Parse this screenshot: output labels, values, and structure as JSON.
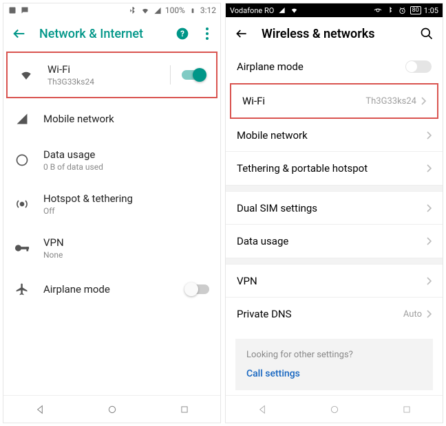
{
  "left": {
    "statusbar": {
      "battery": "100%",
      "time": "3:12"
    },
    "header": {
      "title": "Network & Internet"
    },
    "items": {
      "wifi": {
        "label": "Wi-Fi",
        "sub": "Th3G33ks24"
      },
      "mobile": {
        "label": "Mobile network"
      },
      "data": {
        "label": "Data usage",
        "sub": "0 B of data used"
      },
      "hotspot": {
        "label": "Hotspot & tethering",
        "sub": "Off"
      },
      "vpn": {
        "label": "VPN",
        "sub": "None"
      },
      "airplane": {
        "label": "Airplane mode"
      }
    }
  },
  "right": {
    "statusbar": {
      "carrier": "Vodafone RO",
      "battery": "80",
      "time": "1:05"
    },
    "header": {
      "title": "Wireless & networks"
    },
    "items": {
      "airplane": {
        "label": "Airplane mode"
      },
      "wifi": {
        "label": "Wi-Fi",
        "value": "Th3G33ks24"
      },
      "mobile": {
        "label": "Mobile network"
      },
      "tether": {
        "label": "Tethering & portable hotspot"
      },
      "dualsim": {
        "label": "Dual SIM settings"
      },
      "data": {
        "label": "Data usage"
      },
      "vpn": {
        "label": "VPN"
      },
      "dns": {
        "label": "Private DNS",
        "value": "Auto"
      }
    },
    "infobox": {
      "hint": "Looking for other settings?",
      "link": "Call settings"
    }
  }
}
